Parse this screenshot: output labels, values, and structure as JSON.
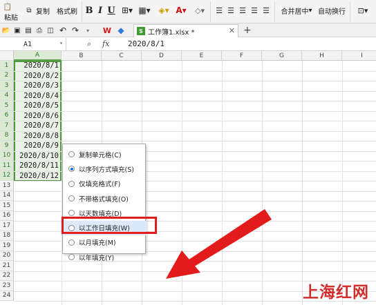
{
  "ribbon": {
    "paste": "粘贴",
    "copy": "复制",
    "format_painter": "格式刷",
    "bold": "B",
    "italic": "I",
    "underline": "U",
    "merge_center": "合并居中",
    "auto_wrap": "自动换行"
  },
  "document_tab": {
    "title": "工作簿1.xlsx *"
  },
  "formula_bar": {
    "name_box": "A1",
    "fx": "fx",
    "value": "2020/8/1"
  },
  "columns": [
    "A",
    "B",
    "C",
    "D",
    "E",
    "F",
    "G",
    "H",
    "I"
  ],
  "rows": [
    "1",
    "2",
    "3",
    "4",
    "5",
    "6",
    "7",
    "8",
    "9",
    "10",
    "11",
    "12",
    "13",
    "14",
    "15",
    "16",
    "17",
    "18",
    "19",
    "20",
    "21",
    "22",
    "23",
    "24"
  ],
  "cells": [
    "2020/8/1",
    "2020/8/2",
    "2020/8/3",
    "2020/8/4",
    "2020/8/5",
    "2020/8/6",
    "2020/8/7",
    "2020/8/8",
    "2020/8/9",
    "2020/8/10",
    "2020/8/11",
    "2020/8/12"
  ],
  "autofill_menu": {
    "items": [
      "复制单元格(C)",
      "以序列方式填充(S)",
      "仅填充格式(F)",
      "不带格式填充(O)",
      "以天数填充(D)",
      "以工作日填充(W)",
      "以月填充(M)",
      "以年填充(Y)"
    ],
    "selected": 1,
    "highlighted": 5
  },
  "watermark": "上海红网",
  "colors": {
    "selection_border": "#4e9a3c",
    "annotation": "#e21b1b"
  }
}
